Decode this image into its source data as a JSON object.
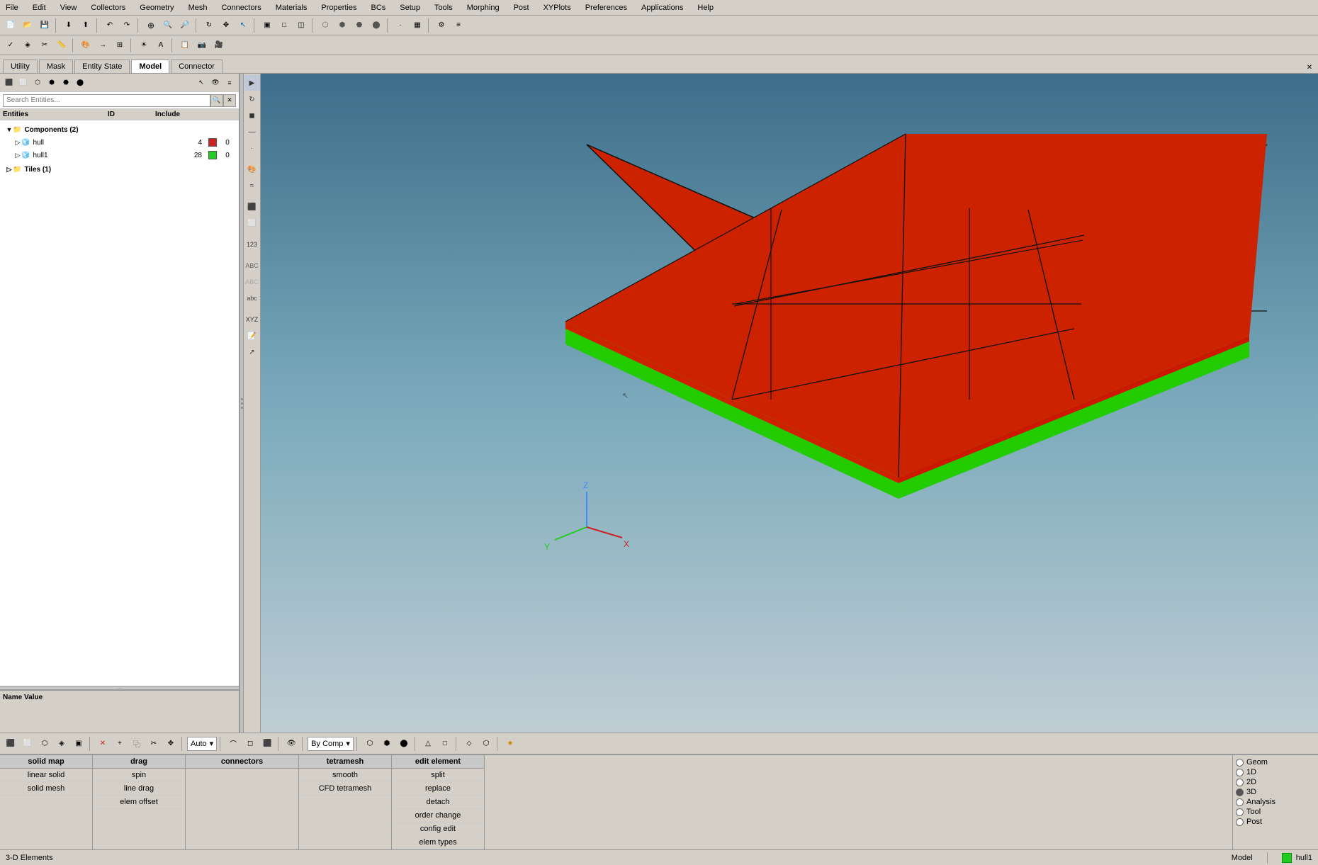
{
  "menu": {
    "items": [
      "File",
      "Edit",
      "View",
      "Collectors",
      "Geometry",
      "Mesh",
      "Connectors",
      "Materials",
      "Properties",
      "BCs",
      "Setup",
      "Tools",
      "Morphing",
      "Post",
      "XYPlots",
      "Preferences",
      "Applications",
      "Help"
    ]
  },
  "tabs": {
    "items": [
      "Utility",
      "Mask",
      "Entity State",
      "Model",
      "Connector"
    ]
  },
  "search": {
    "placeholder": "Search Entities..."
  },
  "entity_tree": {
    "headers": [
      "Entities",
      "ID",
      "",
      "Include"
    ],
    "components_label": "Components (2)",
    "items": [
      {
        "name": "hull",
        "id": "4",
        "color": "#cc2222",
        "include": "0"
      },
      {
        "name": "hull1",
        "id": "28",
        "color": "#22cc22",
        "include": "0"
      }
    ],
    "tiles_label": "Tiles (1)"
  },
  "name_value": {
    "label": "Name Value"
  },
  "bottom_tools": {
    "columns": [
      {
        "header": "solid map",
        "cells": [
          "linear solid",
          "solid mesh"
        ]
      },
      {
        "header": "drag",
        "cells": [
          "spin",
          "line drag",
          "elem offset"
        ]
      },
      {
        "header": "connectors",
        "cells": []
      },
      {
        "header": "tetramesh",
        "cells": [
          "smooth",
          "CFD tetramesh"
        ]
      },
      {
        "header": "edit element",
        "cells": [
          "split",
          "replace",
          "detach",
          "order change",
          "config edit",
          "elem types"
        ]
      }
    ],
    "right_options": [
      {
        "label": "Geom"
      },
      {
        "label": "1D"
      },
      {
        "label": "2D"
      },
      {
        "label": "3D"
      },
      {
        "label": "Analysis"
      },
      {
        "label": "Tool"
      },
      {
        "label": "Post"
      }
    ]
  },
  "status_bar": {
    "left_label": "3-D Elements",
    "model_label": "Model",
    "hull1_label": "hull1"
  },
  "viewport": {
    "background_top": "#4a7fa0",
    "background_bottom": "#b8cdd8"
  },
  "toolbar1_icons": [
    "new",
    "open",
    "save",
    "",
    "cut",
    "copy",
    "paste",
    "",
    "undo",
    "redo",
    "",
    "zoom-fit",
    "zoom-in",
    "zoom-out",
    "rotate",
    "pan",
    "select"
  ],
  "toolbar2_icons": [
    "mesh",
    "check",
    "",
    "morph",
    "",
    "view1",
    "view2",
    "view3",
    "view4",
    "",
    "shading",
    "wireframe",
    "",
    "nodes",
    "elements"
  ]
}
